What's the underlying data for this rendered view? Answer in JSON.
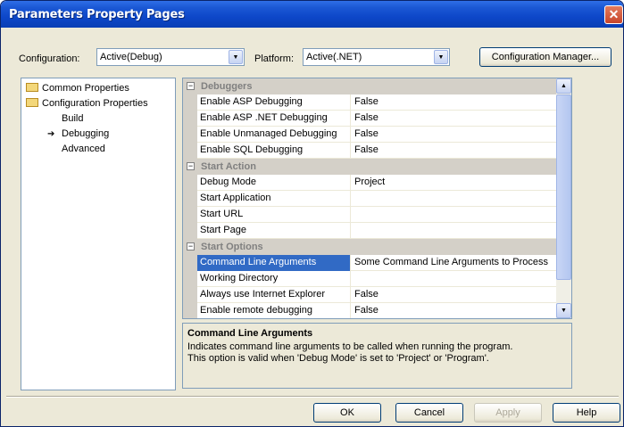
{
  "window": {
    "title": "Parameters Property Pages",
    "close_glyph": "✕"
  },
  "toolbar": {
    "configuration_label": "Configuration:",
    "configuration_value": "Active(Debug)",
    "platform_label": "Platform:",
    "platform_value": "Active(.NET)",
    "config_manager_label": "Configuration Manager..."
  },
  "tree": {
    "items": [
      {
        "label": "Common Properties"
      },
      {
        "label": "Configuration Properties"
      },
      {
        "label": "Build"
      },
      {
        "label": "Debugging"
      },
      {
        "label": "Advanced"
      }
    ],
    "selected_marker": "➔"
  },
  "grid": {
    "categories": [
      {
        "label": "Debuggers",
        "expander": "⊟"
      },
      {
        "label": "Start Action",
        "expander": "⊟"
      },
      {
        "label": "Start Options",
        "expander": "⊟"
      }
    ],
    "rows": [
      {
        "name": "Enable ASP Debugging",
        "value": "False"
      },
      {
        "name": "Enable ASP .NET Debugging",
        "value": "False"
      },
      {
        "name": "Enable Unmanaged Debugging",
        "value": "False"
      },
      {
        "name": "Enable SQL Debugging",
        "value": "False"
      },
      {
        "name": "Debug Mode",
        "value": "Project"
      },
      {
        "name": "Start Application",
        "value": ""
      },
      {
        "name": "Start URL",
        "value": ""
      },
      {
        "name": "Start Page",
        "value": ""
      },
      {
        "name": "Command Line Arguments",
        "value": "Some Command Line Arguments to Process"
      },
      {
        "name": "Working Directory",
        "value": ""
      },
      {
        "name": "Always use Internet Explorer",
        "value": "False"
      },
      {
        "name": "Enable remote debugging",
        "value": "False"
      }
    ]
  },
  "description": {
    "title": "Command Line Arguments",
    "body_line1": "Indicates command line arguments to be called when running the program.",
    "body_line2": "This option is valid when 'Debug Mode' is set to 'Project' or 'Program'."
  },
  "buttons": {
    "ok": "OK",
    "cancel": "Cancel",
    "apply": "Apply",
    "help": "Help"
  },
  "icons": {
    "dropdown": "dropdown-arrow-icon",
    "scroll_up": "scroll-up-icon",
    "scroll_down": "scroll-down-icon",
    "folder": "folder-icon"
  },
  "colors": {
    "title_bar": "#0d47c9",
    "selection": "#316ac5",
    "dialog_bg": "#ece9d8"
  }
}
